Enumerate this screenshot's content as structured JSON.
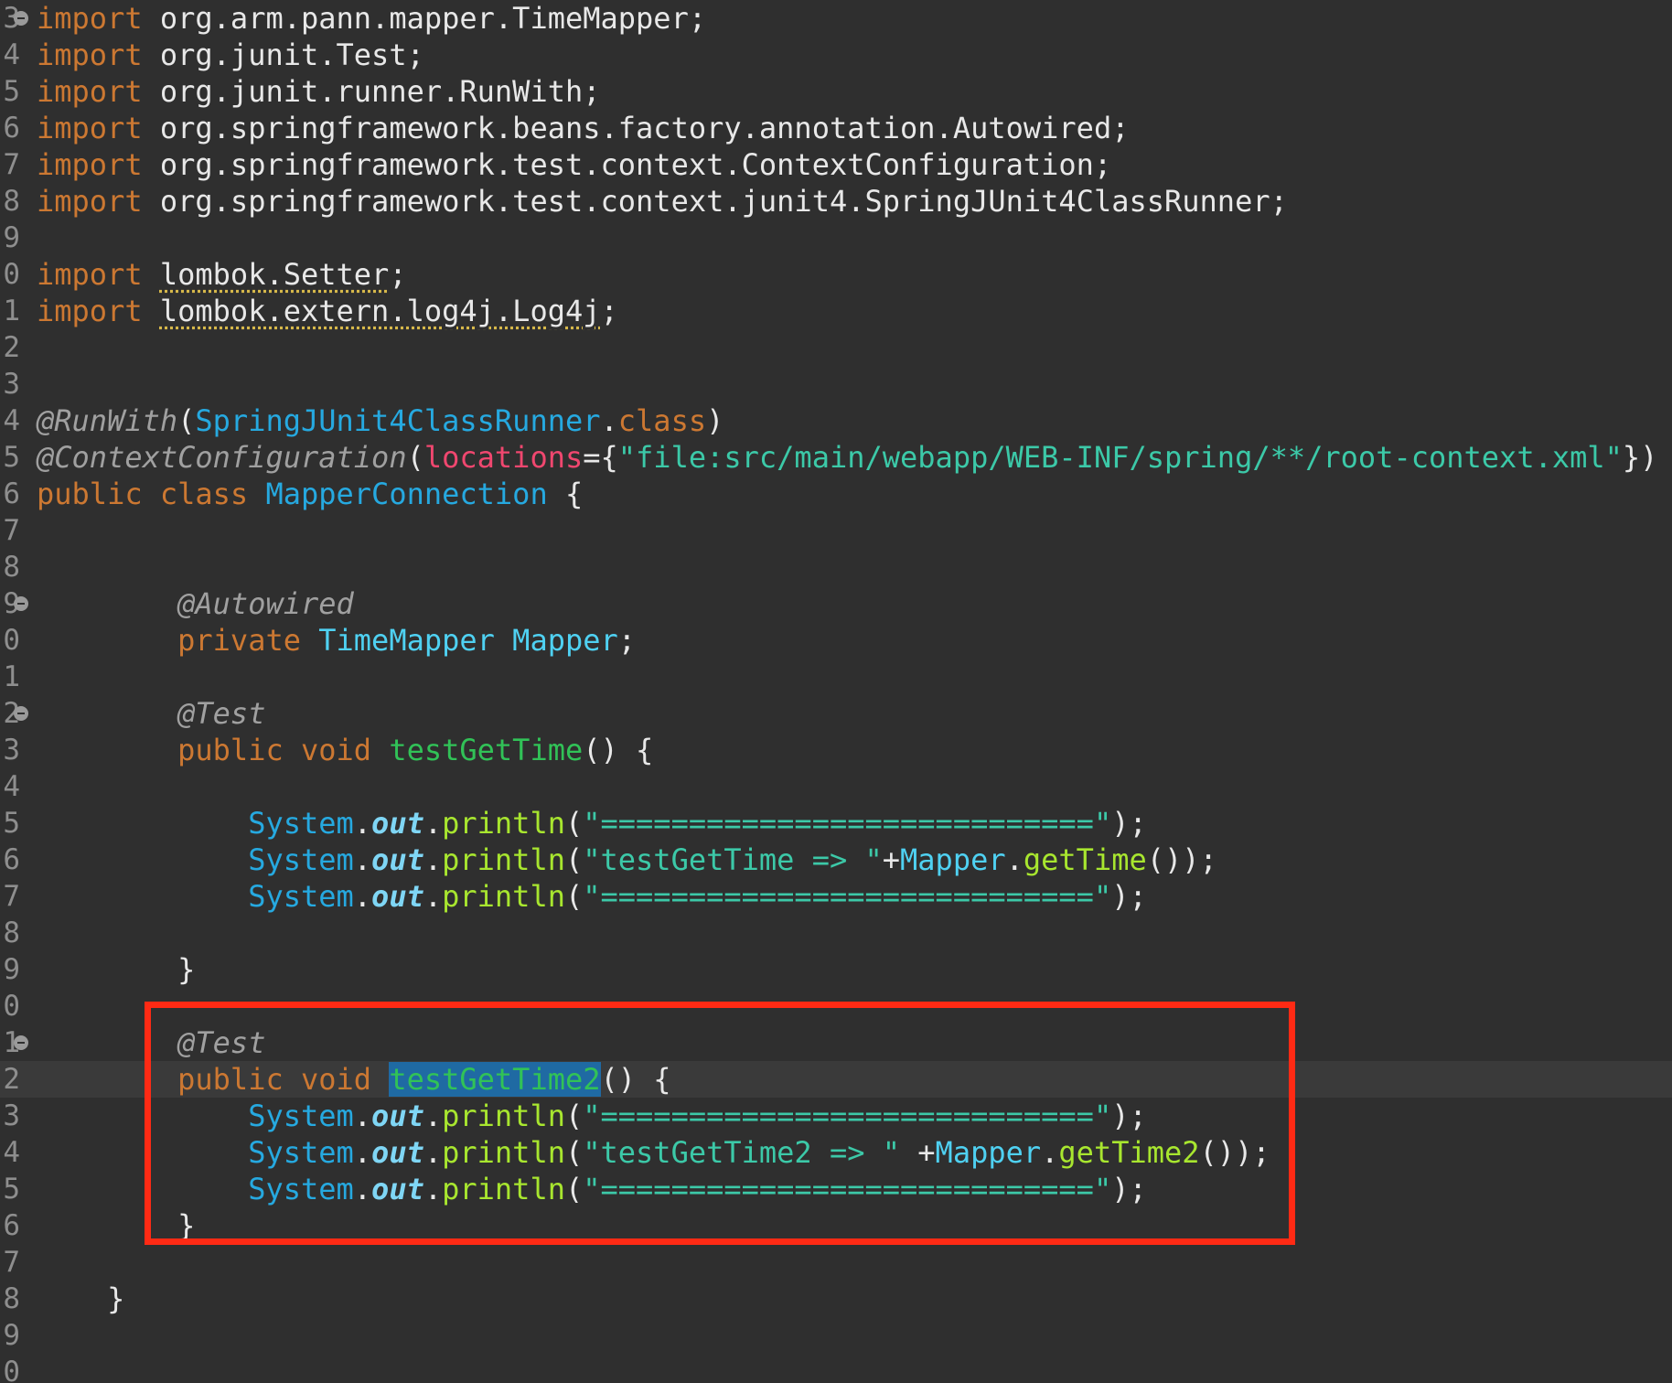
{
  "lines": [
    {
      "num": "3",
      "fold": true
    },
    {
      "num": "4"
    },
    {
      "num": "5"
    },
    {
      "num": "6"
    },
    {
      "num": "7"
    },
    {
      "num": "8"
    },
    {
      "num": "9"
    },
    {
      "num": "0"
    },
    {
      "num": "1"
    },
    {
      "num": "2"
    },
    {
      "num": "3"
    },
    {
      "num": "4"
    },
    {
      "num": "5"
    },
    {
      "num": "6"
    },
    {
      "num": "7"
    },
    {
      "num": "8"
    },
    {
      "num": "9",
      "fold": true
    },
    {
      "num": "0"
    },
    {
      "num": "1"
    },
    {
      "num": "2",
      "fold": true
    },
    {
      "num": "3"
    },
    {
      "num": "4"
    },
    {
      "num": "5"
    },
    {
      "num": "6"
    },
    {
      "num": "7"
    },
    {
      "num": "8"
    },
    {
      "num": "9"
    },
    {
      "num": "0"
    },
    {
      "num": "1",
      "fold": true
    },
    {
      "num": "2"
    },
    {
      "num": "3"
    },
    {
      "num": "4"
    },
    {
      "num": "5"
    },
    {
      "num": "6"
    },
    {
      "num": "7"
    },
    {
      "num": "8"
    },
    {
      "num": "9"
    },
    {
      "num": "0"
    }
  ],
  "tokens": {
    "import": "import",
    "imp1": "org.arm.pann.mapper.TimeMapper;",
    "imp2": "org.junit.Test;",
    "imp3": "org.junit.runner.RunWith;",
    "imp4": "org.springframework.beans.factory.annotation.Autowired;",
    "imp5": "org.springframework.test.context.ContextConfiguration;",
    "imp6": "org.springframework.test.context.junit4.SpringJUnit4ClassRunner;",
    "imp7": "lombok.Setter",
    "imp8": "lombok.extern.log4j.Log4j",
    "semi": ";",
    "runwith": "@RunWith",
    "lparen": "(",
    "rparen": ")",
    "runner": "SpringJUnit4ClassRunner",
    "dot": ".",
    "class": "class",
    "ctxconf": "@ContextConfiguration",
    "locations": "locations",
    "eqbrace": "={",
    "location_str": "\"file:src/main/webapp/WEB-INF/spring/**/root-context.xml\"",
    "close_ann": "})",
    "public": "public",
    "class_name": "MapperConnection",
    "lbrace": "{",
    "rbrace": "}",
    "autowired": "@Autowired",
    "private": "private",
    "timemapper": "TimeMapper",
    "mapper": "Mapper",
    "test_ann": "@Test",
    "void": "void",
    "method1": "testGetTime",
    "method2": "testGetTime2",
    "parens": "()",
    "system": "System",
    "out": "out",
    "println": "println",
    "sep_str": "\"============================\"",
    "str1": "\"testGetTime => \"",
    "str2": "\"testGetTime2 => \"",
    "plus": "+",
    "space_plus": " +",
    "gettime": "getTime",
    "gettime2": "getTime2",
    "end_call": "());",
    "end_sep": ");"
  }
}
